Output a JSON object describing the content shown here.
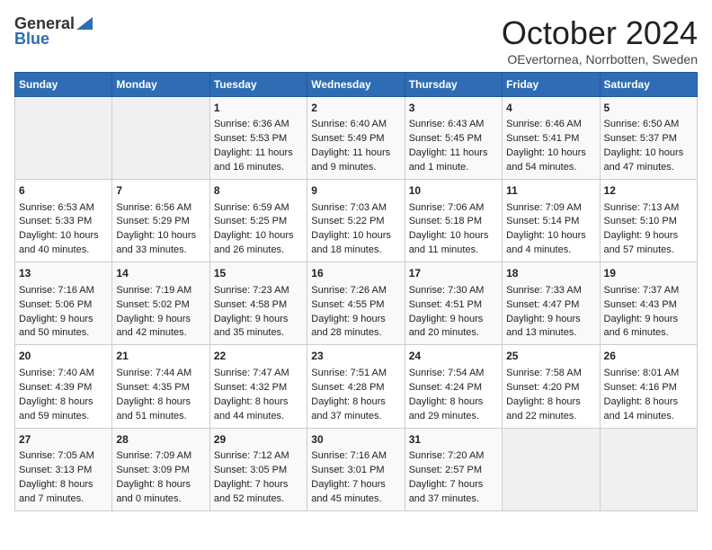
{
  "logo": {
    "general": "General",
    "blue": "Blue"
  },
  "title": "October 2024",
  "subtitle": "OEvertornea, Norrbotten, Sweden",
  "days_of_week": [
    "Sunday",
    "Monday",
    "Tuesday",
    "Wednesday",
    "Thursday",
    "Friday",
    "Saturday"
  ],
  "weeks": [
    [
      {
        "day": "",
        "content": ""
      },
      {
        "day": "",
        "content": ""
      },
      {
        "day": "1",
        "content": "Sunrise: 6:36 AM\nSunset: 5:53 PM\nDaylight: 11 hours\nand 16 minutes."
      },
      {
        "day": "2",
        "content": "Sunrise: 6:40 AM\nSunset: 5:49 PM\nDaylight: 11 hours\nand 9 minutes."
      },
      {
        "day": "3",
        "content": "Sunrise: 6:43 AM\nSunset: 5:45 PM\nDaylight: 11 hours\nand 1 minute."
      },
      {
        "day": "4",
        "content": "Sunrise: 6:46 AM\nSunset: 5:41 PM\nDaylight: 10 hours\nand 54 minutes."
      },
      {
        "day": "5",
        "content": "Sunrise: 6:50 AM\nSunset: 5:37 PM\nDaylight: 10 hours\nand 47 minutes."
      }
    ],
    [
      {
        "day": "6",
        "content": "Sunrise: 6:53 AM\nSunset: 5:33 PM\nDaylight: 10 hours\nand 40 minutes."
      },
      {
        "day": "7",
        "content": "Sunrise: 6:56 AM\nSunset: 5:29 PM\nDaylight: 10 hours\nand 33 minutes."
      },
      {
        "day": "8",
        "content": "Sunrise: 6:59 AM\nSunset: 5:25 PM\nDaylight: 10 hours\nand 26 minutes."
      },
      {
        "day": "9",
        "content": "Sunrise: 7:03 AM\nSunset: 5:22 PM\nDaylight: 10 hours\nand 18 minutes."
      },
      {
        "day": "10",
        "content": "Sunrise: 7:06 AM\nSunset: 5:18 PM\nDaylight: 10 hours\nand 11 minutes."
      },
      {
        "day": "11",
        "content": "Sunrise: 7:09 AM\nSunset: 5:14 PM\nDaylight: 10 hours\nand 4 minutes."
      },
      {
        "day": "12",
        "content": "Sunrise: 7:13 AM\nSunset: 5:10 PM\nDaylight: 9 hours\nand 57 minutes."
      }
    ],
    [
      {
        "day": "13",
        "content": "Sunrise: 7:16 AM\nSunset: 5:06 PM\nDaylight: 9 hours\nand 50 minutes."
      },
      {
        "day": "14",
        "content": "Sunrise: 7:19 AM\nSunset: 5:02 PM\nDaylight: 9 hours\nand 42 minutes."
      },
      {
        "day": "15",
        "content": "Sunrise: 7:23 AM\nSunset: 4:58 PM\nDaylight: 9 hours\nand 35 minutes."
      },
      {
        "day": "16",
        "content": "Sunrise: 7:26 AM\nSunset: 4:55 PM\nDaylight: 9 hours\nand 28 minutes."
      },
      {
        "day": "17",
        "content": "Sunrise: 7:30 AM\nSunset: 4:51 PM\nDaylight: 9 hours\nand 20 minutes."
      },
      {
        "day": "18",
        "content": "Sunrise: 7:33 AM\nSunset: 4:47 PM\nDaylight: 9 hours\nand 13 minutes."
      },
      {
        "day": "19",
        "content": "Sunrise: 7:37 AM\nSunset: 4:43 PM\nDaylight: 9 hours\nand 6 minutes."
      }
    ],
    [
      {
        "day": "20",
        "content": "Sunrise: 7:40 AM\nSunset: 4:39 PM\nDaylight: 8 hours\nand 59 minutes."
      },
      {
        "day": "21",
        "content": "Sunrise: 7:44 AM\nSunset: 4:35 PM\nDaylight: 8 hours\nand 51 minutes."
      },
      {
        "day": "22",
        "content": "Sunrise: 7:47 AM\nSunset: 4:32 PM\nDaylight: 8 hours\nand 44 minutes."
      },
      {
        "day": "23",
        "content": "Sunrise: 7:51 AM\nSunset: 4:28 PM\nDaylight: 8 hours\nand 37 minutes."
      },
      {
        "day": "24",
        "content": "Sunrise: 7:54 AM\nSunset: 4:24 PM\nDaylight: 8 hours\nand 29 minutes."
      },
      {
        "day": "25",
        "content": "Sunrise: 7:58 AM\nSunset: 4:20 PM\nDaylight: 8 hours\nand 22 minutes."
      },
      {
        "day": "26",
        "content": "Sunrise: 8:01 AM\nSunset: 4:16 PM\nDaylight: 8 hours\nand 14 minutes."
      }
    ],
    [
      {
        "day": "27",
        "content": "Sunrise: 7:05 AM\nSunset: 3:13 PM\nDaylight: 8 hours\nand 7 minutes."
      },
      {
        "day": "28",
        "content": "Sunrise: 7:09 AM\nSunset: 3:09 PM\nDaylight: 8 hours\nand 0 minutes."
      },
      {
        "day": "29",
        "content": "Sunrise: 7:12 AM\nSunset: 3:05 PM\nDaylight: 7 hours\nand 52 minutes."
      },
      {
        "day": "30",
        "content": "Sunrise: 7:16 AM\nSunset: 3:01 PM\nDaylight: 7 hours\nand 45 minutes."
      },
      {
        "day": "31",
        "content": "Sunrise: 7:20 AM\nSunset: 2:57 PM\nDaylight: 7 hours\nand 37 minutes."
      },
      {
        "day": "",
        "content": ""
      },
      {
        "day": "",
        "content": ""
      }
    ]
  ]
}
